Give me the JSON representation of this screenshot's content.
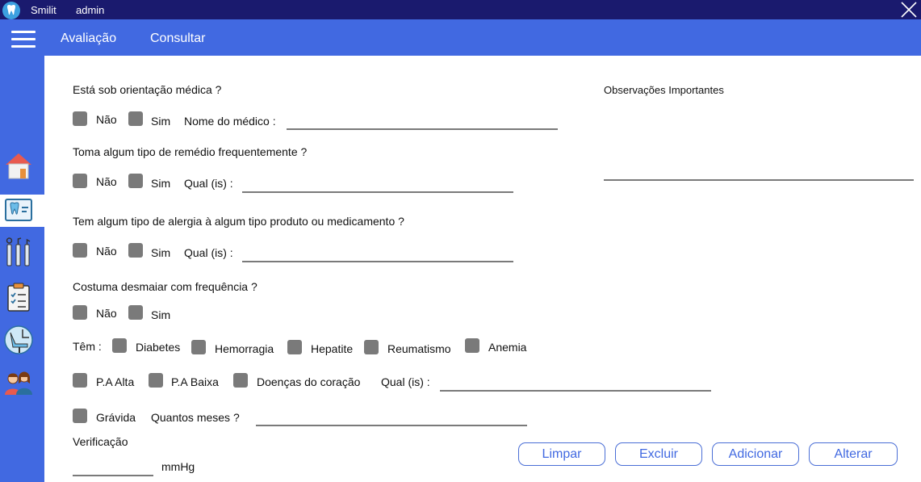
{
  "titlebar": {
    "app_name": "Smilit",
    "user": "admin"
  },
  "navbar": {
    "links": [
      "Avaliação",
      "Consultar"
    ]
  },
  "sidebar": {
    "icons": [
      "home-icon",
      "dental-record-icon",
      "dental-tools-icon",
      "checklist-icon",
      "dental-chair-icon",
      "patients-icon"
    ]
  },
  "form": {
    "q1": {
      "question": "Está sob orientação médica ?",
      "no": "Não",
      "yes": "Sim",
      "detail_label": "Nome do médico :",
      "detail_value": ""
    },
    "q2": {
      "question": "Toma algum tipo de remédio frequentemente ?",
      "no": "Não",
      "yes": "Sim",
      "detail_label": "Qual (is) :",
      "detail_value": ""
    },
    "q3": {
      "question": "Tem algum tipo de alergia à algum tipo produto ou medicamento ?",
      "no": "Não",
      "yes": "Sim",
      "detail_label": "Qual (is) :",
      "detail_value": ""
    },
    "q4": {
      "question": "Costuma desmaiar com frequência ?",
      "no": "Não",
      "yes": "Sim"
    },
    "conditions": {
      "label": "Têm :",
      "row1": [
        "Diabetes",
        "Hemorragia",
        "Hepatite",
        "Reumatismo",
        "Anemia"
      ],
      "row2": [
        "P.A Alta",
        "P.A Baixa",
        "Doenças do coração"
      ],
      "detail_label": "Qual (is) :",
      "detail_value": ""
    },
    "pregnant": {
      "label": "Grávida",
      "months_label": "Quantos meses ?",
      "months_value": ""
    },
    "verification": {
      "label": "Verificação",
      "value": "",
      "unit": "mmHg"
    },
    "observations": {
      "label": "Observações Importantes",
      "value": ""
    }
  },
  "buttons": {
    "clear": "Limpar",
    "delete": "Excluir",
    "add": "Adicionar",
    "update": "Alterar"
  },
  "colors": {
    "titlebar": "#1a1a6e",
    "accent": "#4169e1",
    "checkbox": "#7a7a7a",
    "button_border": "#4a6ed6"
  }
}
